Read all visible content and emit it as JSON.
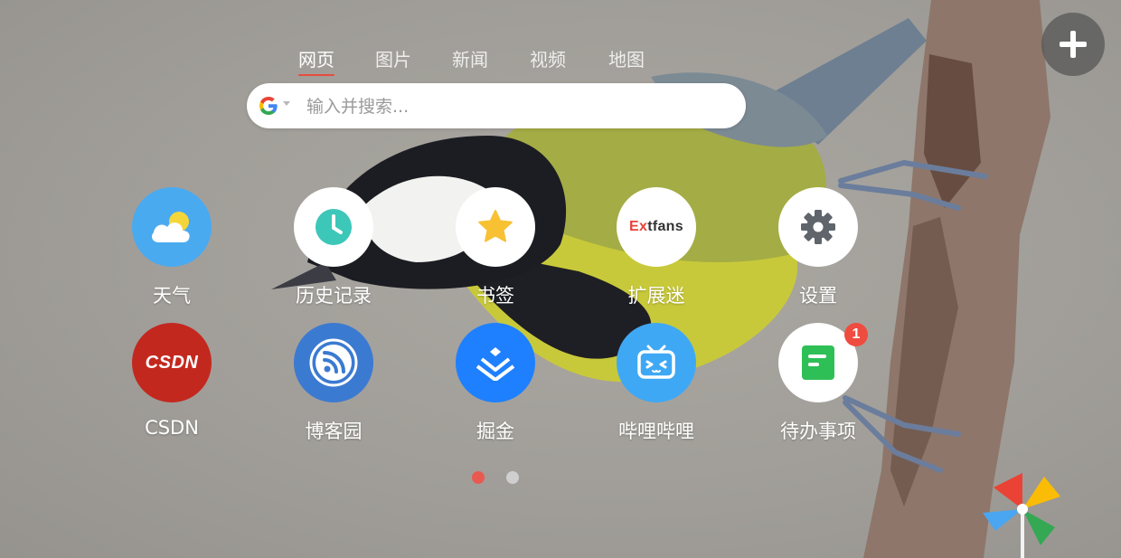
{
  "tabs": [
    {
      "label": "网页",
      "active": true
    },
    {
      "label": "图片",
      "active": false
    },
    {
      "label": "新闻",
      "active": false
    },
    {
      "label": "视频",
      "active": false
    },
    {
      "label": "地图",
      "active": false
    }
  ],
  "search": {
    "engine_icon": "google-icon",
    "placeholder": "输入并搜索...",
    "value": ""
  },
  "add_button": {
    "icon": "plus-icon"
  },
  "tiles": [
    {
      "label": "天气",
      "icon": "weather-icon",
      "bg": "#4aaaf0"
    },
    {
      "label": "历史记录",
      "icon": "clock-icon",
      "bg": "#ffffff"
    },
    {
      "label": "书签",
      "icon": "star-icon",
      "bg": "#ffffff"
    },
    {
      "label": "扩展迷",
      "icon": "extfans-logo",
      "logo_red": "Ex",
      "logo_dark": "tfans",
      "bg": "#ffffff"
    },
    {
      "label": "设置",
      "icon": "gear-icon",
      "bg": "#ffffff"
    },
    {
      "label": "CSDN",
      "icon": "csdn-logo",
      "logo_text": "CSDN",
      "bg": "#c3281f"
    },
    {
      "label": "博客园",
      "icon": "rss-icon",
      "bg": "#3b7ad1"
    },
    {
      "label": "掘金",
      "icon": "juejin-icon",
      "bg": "#1e80ff"
    },
    {
      "label": "哔哩哔哩",
      "icon": "bilibili-tv-icon",
      "bg": "#3fa8f5"
    },
    {
      "label": "待办事项",
      "icon": "todo-icon",
      "bg": "#ffffff",
      "badge": "1"
    }
  ],
  "pagination": {
    "pages": 2,
    "current": 1,
    "active_color": "#e85a4f",
    "inactive_color": "#cfcfcf"
  },
  "colors": {
    "accent": "#e74c3c",
    "badge": "#ef4b3f"
  }
}
